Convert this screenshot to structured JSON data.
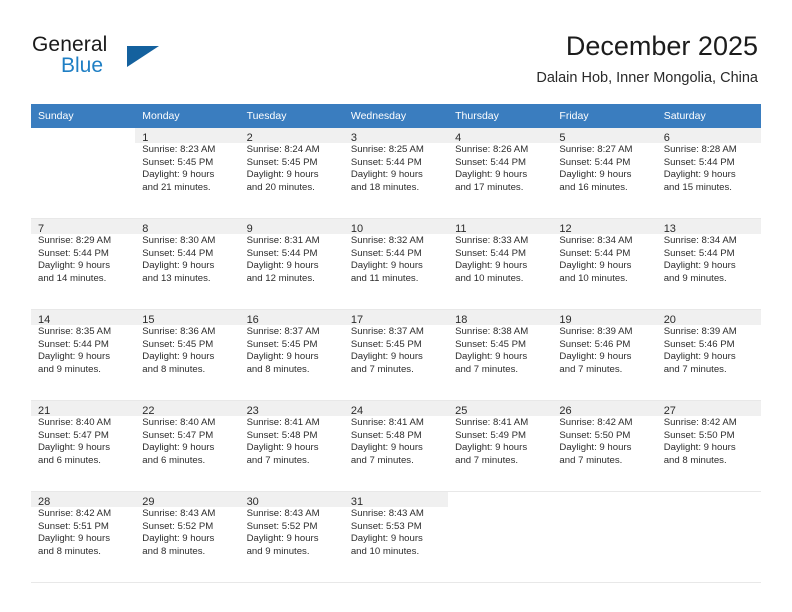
{
  "brand": {
    "name_part1": "General",
    "name_part2": "Blue",
    "triangle_color": "#14619e",
    "blue_color": "#1f7fc4"
  },
  "header": {
    "title": "December 2025",
    "subtitle": "Dalain Hob, Inner Mongolia, China"
  },
  "calendar": {
    "header_bg": "#3a7dbf",
    "weekday_headers": [
      "Sunday",
      "Monday",
      "Tuesday",
      "Wednesday",
      "Thursday",
      "Friday",
      "Saturday"
    ],
    "weeks": [
      [
        {
          "day": "",
          "sunrise": "",
          "sunset": "",
          "daylight_line1": "",
          "daylight_line2": ""
        },
        {
          "day": "1",
          "sunrise": "Sunrise: 8:23 AM",
          "sunset": "Sunset: 5:45 PM",
          "daylight_line1": "Daylight: 9 hours",
          "daylight_line2": "and 21 minutes."
        },
        {
          "day": "2",
          "sunrise": "Sunrise: 8:24 AM",
          "sunset": "Sunset: 5:45 PM",
          "daylight_line1": "Daylight: 9 hours",
          "daylight_line2": "and 20 minutes."
        },
        {
          "day": "3",
          "sunrise": "Sunrise: 8:25 AM",
          "sunset": "Sunset: 5:44 PM",
          "daylight_line1": "Daylight: 9 hours",
          "daylight_line2": "and 18 minutes."
        },
        {
          "day": "4",
          "sunrise": "Sunrise: 8:26 AM",
          "sunset": "Sunset: 5:44 PM",
          "daylight_line1": "Daylight: 9 hours",
          "daylight_line2": "and 17 minutes."
        },
        {
          "day": "5",
          "sunrise": "Sunrise: 8:27 AM",
          "sunset": "Sunset: 5:44 PM",
          "daylight_line1": "Daylight: 9 hours",
          "daylight_line2": "and 16 minutes."
        },
        {
          "day": "6",
          "sunrise": "Sunrise: 8:28 AM",
          "sunset": "Sunset: 5:44 PM",
          "daylight_line1": "Daylight: 9 hours",
          "daylight_line2": "and 15 minutes."
        }
      ],
      [
        {
          "day": "7",
          "sunrise": "Sunrise: 8:29 AM",
          "sunset": "Sunset: 5:44 PM",
          "daylight_line1": "Daylight: 9 hours",
          "daylight_line2": "and 14 minutes."
        },
        {
          "day": "8",
          "sunrise": "Sunrise: 8:30 AM",
          "sunset": "Sunset: 5:44 PM",
          "daylight_line1": "Daylight: 9 hours",
          "daylight_line2": "and 13 minutes."
        },
        {
          "day": "9",
          "sunrise": "Sunrise: 8:31 AM",
          "sunset": "Sunset: 5:44 PM",
          "daylight_line1": "Daylight: 9 hours",
          "daylight_line2": "and 12 minutes."
        },
        {
          "day": "10",
          "sunrise": "Sunrise: 8:32 AM",
          "sunset": "Sunset: 5:44 PM",
          "daylight_line1": "Daylight: 9 hours",
          "daylight_line2": "and 11 minutes."
        },
        {
          "day": "11",
          "sunrise": "Sunrise: 8:33 AM",
          "sunset": "Sunset: 5:44 PM",
          "daylight_line1": "Daylight: 9 hours",
          "daylight_line2": "and 10 minutes."
        },
        {
          "day": "12",
          "sunrise": "Sunrise: 8:34 AM",
          "sunset": "Sunset: 5:44 PM",
          "daylight_line1": "Daylight: 9 hours",
          "daylight_line2": "and 10 minutes."
        },
        {
          "day": "13",
          "sunrise": "Sunrise: 8:34 AM",
          "sunset": "Sunset: 5:44 PM",
          "daylight_line1": "Daylight: 9 hours",
          "daylight_line2": "and 9 minutes."
        }
      ],
      [
        {
          "day": "14",
          "sunrise": "Sunrise: 8:35 AM",
          "sunset": "Sunset: 5:44 PM",
          "daylight_line1": "Daylight: 9 hours",
          "daylight_line2": "and 9 minutes."
        },
        {
          "day": "15",
          "sunrise": "Sunrise: 8:36 AM",
          "sunset": "Sunset: 5:45 PM",
          "daylight_line1": "Daylight: 9 hours",
          "daylight_line2": "and 8 minutes."
        },
        {
          "day": "16",
          "sunrise": "Sunrise: 8:37 AM",
          "sunset": "Sunset: 5:45 PM",
          "daylight_line1": "Daylight: 9 hours",
          "daylight_line2": "and 8 minutes."
        },
        {
          "day": "17",
          "sunrise": "Sunrise: 8:37 AM",
          "sunset": "Sunset: 5:45 PM",
          "daylight_line1": "Daylight: 9 hours",
          "daylight_line2": "and 7 minutes."
        },
        {
          "day": "18",
          "sunrise": "Sunrise: 8:38 AM",
          "sunset": "Sunset: 5:45 PM",
          "daylight_line1": "Daylight: 9 hours",
          "daylight_line2": "and 7 minutes."
        },
        {
          "day": "19",
          "sunrise": "Sunrise: 8:39 AM",
          "sunset": "Sunset: 5:46 PM",
          "daylight_line1": "Daylight: 9 hours",
          "daylight_line2": "and 7 minutes."
        },
        {
          "day": "20",
          "sunrise": "Sunrise: 8:39 AM",
          "sunset": "Sunset: 5:46 PM",
          "daylight_line1": "Daylight: 9 hours",
          "daylight_line2": "and 7 minutes."
        }
      ],
      [
        {
          "day": "21",
          "sunrise": "Sunrise: 8:40 AM",
          "sunset": "Sunset: 5:47 PM",
          "daylight_line1": "Daylight: 9 hours",
          "daylight_line2": "and 6 minutes."
        },
        {
          "day": "22",
          "sunrise": "Sunrise: 8:40 AM",
          "sunset": "Sunset: 5:47 PM",
          "daylight_line1": "Daylight: 9 hours",
          "daylight_line2": "and 6 minutes."
        },
        {
          "day": "23",
          "sunrise": "Sunrise: 8:41 AM",
          "sunset": "Sunset: 5:48 PM",
          "daylight_line1": "Daylight: 9 hours",
          "daylight_line2": "and 7 minutes."
        },
        {
          "day": "24",
          "sunrise": "Sunrise: 8:41 AM",
          "sunset": "Sunset: 5:48 PM",
          "daylight_line1": "Daylight: 9 hours",
          "daylight_line2": "and 7 minutes."
        },
        {
          "day": "25",
          "sunrise": "Sunrise: 8:41 AM",
          "sunset": "Sunset: 5:49 PM",
          "daylight_line1": "Daylight: 9 hours",
          "daylight_line2": "and 7 minutes."
        },
        {
          "day": "26",
          "sunrise": "Sunrise: 8:42 AM",
          "sunset": "Sunset: 5:50 PM",
          "daylight_line1": "Daylight: 9 hours",
          "daylight_line2": "and 7 minutes."
        },
        {
          "day": "27",
          "sunrise": "Sunrise: 8:42 AM",
          "sunset": "Sunset: 5:50 PM",
          "daylight_line1": "Daylight: 9 hours",
          "daylight_line2": "and 8 minutes."
        }
      ],
      [
        {
          "day": "28",
          "sunrise": "Sunrise: 8:42 AM",
          "sunset": "Sunset: 5:51 PM",
          "daylight_line1": "Daylight: 9 hours",
          "daylight_line2": "and 8 minutes."
        },
        {
          "day": "29",
          "sunrise": "Sunrise: 8:43 AM",
          "sunset": "Sunset: 5:52 PM",
          "daylight_line1": "Daylight: 9 hours",
          "daylight_line2": "and 8 minutes."
        },
        {
          "day": "30",
          "sunrise": "Sunrise: 8:43 AM",
          "sunset": "Sunset: 5:52 PM",
          "daylight_line1": "Daylight: 9 hours",
          "daylight_line2": "and 9 minutes."
        },
        {
          "day": "31",
          "sunrise": "Sunrise: 8:43 AM",
          "sunset": "Sunset: 5:53 PM",
          "daylight_line1": "Daylight: 9 hours",
          "daylight_line2": "and 10 minutes."
        },
        {
          "day": "",
          "sunrise": "",
          "sunset": "",
          "daylight_line1": "",
          "daylight_line2": ""
        },
        {
          "day": "",
          "sunrise": "",
          "sunset": "",
          "daylight_line1": "",
          "daylight_line2": ""
        },
        {
          "day": "",
          "sunrise": "",
          "sunset": "",
          "daylight_line1": "",
          "daylight_line2": ""
        }
      ]
    ]
  }
}
